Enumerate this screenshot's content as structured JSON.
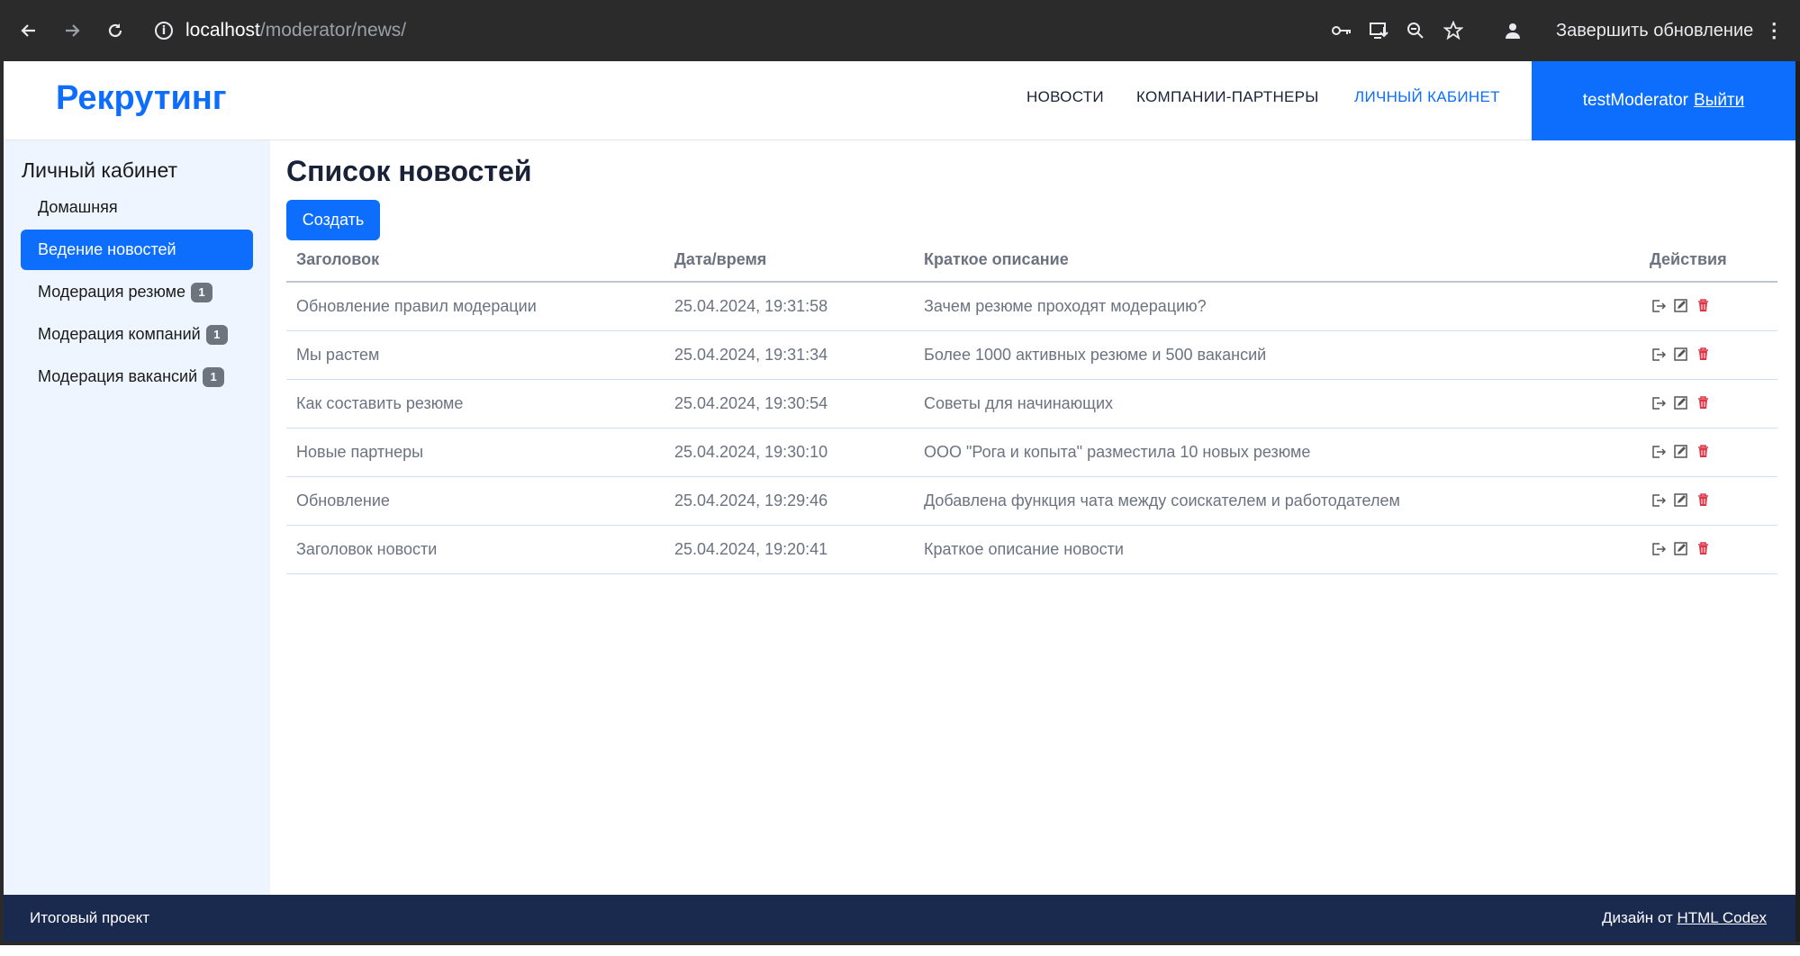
{
  "browser": {
    "url_host": "localhost",
    "url_path": "/moderator/news/",
    "update_label": "Завершить обновление",
    "icons": [
      "back-arrow-icon",
      "forward-arrow-icon",
      "reload-icon",
      "info-icon",
      "key-icon",
      "install-icon",
      "zoom-icon",
      "star-icon",
      "profile-icon",
      "more-vert-icon"
    ]
  },
  "header": {
    "logo": "Рекрутинг",
    "nav": [
      {
        "label": "НОВОСТИ"
      },
      {
        "label": "КОМПАНИИ-ПАРТНЕРЫ"
      },
      {
        "label": "ЛИЧНЫЙ КАБИНЕТ"
      }
    ],
    "username": "testModerator",
    "logout": "Выйти"
  },
  "sidebar": {
    "title": "Личный кабинет",
    "items": [
      {
        "label": "Домашняя",
        "badge": ""
      },
      {
        "label": "Ведение новостей",
        "badge": ""
      },
      {
        "label": "Модерация резюме",
        "badge": "1"
      },
      {
        "label": "Модерация компаний",
        "badge": "1"
      },
      {
        "label": "Модерация вакансий",
        "badge": "1"
      }
    ]
  },
  "main": {
    "title": "Список новостей",
    "create_label": "Создать",
    "columns": [
      "Заголовок",
      "Дата/время",
      "Краткое описание",
      "Действия"
    ],
    "rows": [
      {
        "title": "Обновление правил модерации",
        "date": "25.04.2024, 19:31:58",
        "desc": "Зачем резюме проходят модерацию?"
      },
      {
        "title": "Мы растем",
        "date": "25.04.2024, 19:31:34",
        "desc": "Более 1000 активных резюме и 500 вакансий"
      },
      {
        "title": "Как составить резюме",
        "date": "25.04.2024, 19:30:54",
        "desc": "Советы для начинающих"
      },
      {
        "title": "Новые партнеры",
        "date": "25.04.2024, 19:30:10",
        "desc": "ООО \"Рога и копыта\" разместила 10 новых резюме"
      },
      {
        "title": "Обновление",
        "date": "25.04.2024, 19:29:46",
        "desc": "Добавлена функция чата между соискателем и работодателем"
      },
      {
        "title": "Заголовок новости",
        "date": "25.04.2024, 19:20:41",
        "desc": "Краткое описание новости"
      }
    ],
    "action_icons": [
      "open-icon",
      "edit-icon",
      "delete-icon"
    ]
  },
  "footer": {
    "left": "Итоговый проект",
    "right_prefix": "Дизайн от",
    "right_link": "HTML Codex"
  },
  "colors": {
    "primary": "#0d6efd",
    "footer": "#1a2a4f",
    "sidebar_bg": "#eef5ff",
    "delete": "#dc3545"
  }
}
